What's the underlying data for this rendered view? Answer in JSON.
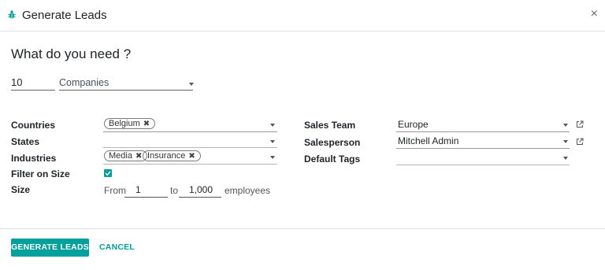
{
  "dialog": {
    "title": "Generate Leads",
    "close_glyph": "×"
  },
  "question": "What do you need ?",
  "request": {
    "count": "10",
    "search_type": "Companies"
  },
  "left_fields": {
    "countries_label": "Countries",
    "countries_tags": [
      "Belgium"
    ],
    "states_label": "States",
    "industries_label": "Industries",
    "industries_tags": [
      "Media",
      "Insurance"
    ],
    "filter_on_size_label": "Filter on Size",
    "filter_on_size_checked": true,
    "size_label": "Size",
    "size_from_label": "From",
    "size_from": "1",
    "size_to_label": "to",
    "size_to": "1,000",
    "size_unit": "employees"
  },
  "right_fields": {
    "sales_team_label": "Sales Team",
    "sales_team": "Europe",
    "salesperson_label": "Salesperson",
    "salesperson": "Mitchell Admin",
    "default_tags_label": "Default Tags",
    "default_tags": ""
  },
  "footer": {
    "primary_label": "GENERATE LEADS",
    "cancel_label": "CANCEL"
  },
  "colors": {
    "accent": "#01a09d",
    "text": "#212529",
    "border": "#dee2e6"
  },
  "icons": {
    "title_icon": "bug-icon",
    "dropdown": "caret-down-icon",
    "external": "external-link-icon",
    "tag_remove": "close-icon"
  },
  "remove_glyph": "✖"
}
